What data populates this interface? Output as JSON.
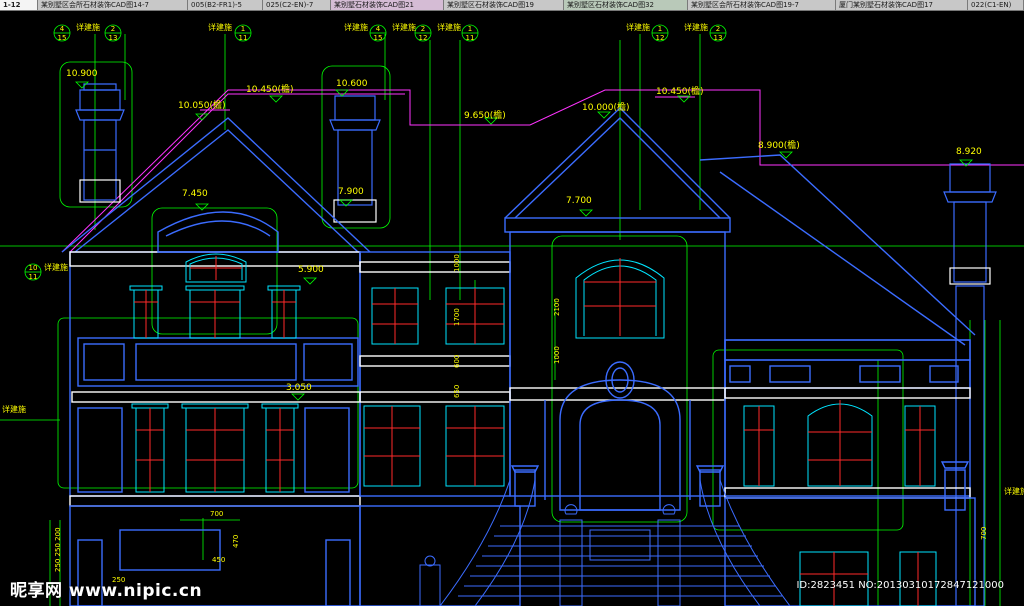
{
  "tabs": [
    {
      "label": "1-12",
      "state": "active"
    },
    {
      "label": "某别墅区会所石材装饰CAD图14-7",
      "state": "normal"
    },
    {
      "label": "005(B2-FR1)-5",
      "state": "normal"
    },
    {
      "label": "025(C2-EN)-7",
      "state": "normal"
    },
    {
      "label": "某别墅石材装饰CAD图21",
      "state": "alt2"
    },
    {
      "label": "某别墅区石材装饰CAD图19",
      "state": "normal"
    },
    {
      "label": "某别墅区石材装饰CAD图32",
      "state": "alt"
    },
    {
      "label": "某别墅区会所石材装饰CAD图19-7",
      "state": "normal"
    },
    {
      "label": "厦门某别墅石材装饰CAD图17",
      "state": "normal"
    },
    {
      "label": "022(C1-EN)",
      "state": "normal"
    }
  ],
  "elevations": {
    "e10900": "10.900",
    "e10600": "10.600",
    "e10050": "10.050(檐)",
    "e10450a": "10.450(檐)",
    "e9650": "9.650(檐)",
    "e10000": "10.000(檐)",
    "e10450b": "10.450(檐)",
    "e8900": "8.900(檐)",
    "e8920": "8.920",
    "e7450": "7.450",
    "e7900": "7.900",
    "e7700": "7.700",
    "e5900": "5.900",
    "e3050": "3.050"
  },
  "notes": {
    "detail": "详建施",
    "dim1000": "1000",
    "dim1700": "1700",
    "dim600": "600",
    "dim650": "650",
    "dim2100": "2100",
    "dim1000b": "1000",
    "dim700": "700",
    "dim450": "450",
    "dim470": "470",
    "dim250": "250",
    "dim700b": "700",
    "dimleft": "250 250 200"
  },
  "callouts": [
    {
      "top": "4",
      "bottom": "15"
    },
    {
      "top": "2",
      "bottom": "13"
    },
    {
      "top": "1",
      "bottom": "11"
    },
    {
      "top": "4",
      "bottom": "15"
    },
    {
      "top": "2",
      "bottom": "12"
    },
    {
      "top": "1",
      "bottom": "11"
    },
    {
      "top": "1",
      "bottom": "12"
    },
    {
      "top": "2",
      "bottom": "13"
    },
    {
      "top": "10",
      "bottom": "11"
    }
  ],
  "watermark": {
    "logo": "昵享网 www.nipic.cn",
    "id_text": "ID:2823451 NO:20130310172847121000"
  },
  "colors": {
    "background": "#000000",
    "outline": "#3b6cff",
    "window": "#00e5ff",
    "mullion": "#ff2a2a",
    "dimension": "#00ff00",
    "leader": "#ff33ff",
    "text": "#ffff00",
    "wall_white": "#ffffff"
  }
}
